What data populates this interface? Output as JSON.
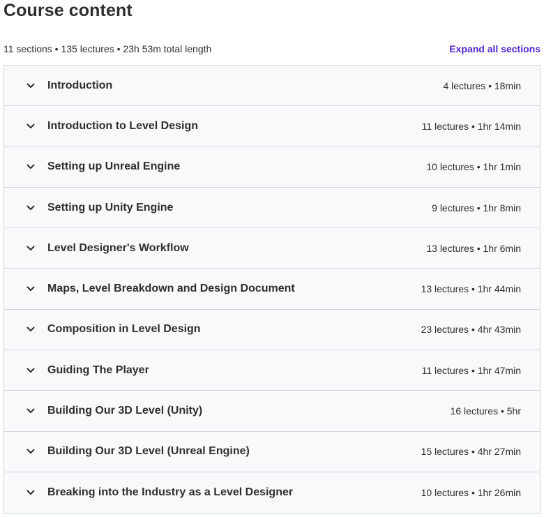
{
  "header": {
    "title": "Course content",
    "summary": "11 sections • 135 lectures • 23h 53m total length",
    "expand_all_label": "Expand all sections"
  },
  "sections": [
    {
      "title": "Introduction",
      "meta": "4 lectures • 18min"
    },
    {
      "title": "Introduction to Level Design",
      "meta": "11 lectures • 1hr 14min"
    },
    {
      "title": "Setting up Unreal Engine",
      "meta": "10 lectures • 1hr 1min"
    },
    {
      "title": "Setting up Unity Engine",
      "meta": "9 lectures • 1hr 8min"
    },
    {
      "title": "Level Designer's Workflow",
      "meta": "13 lectures • 1hr 6min"
    },
    {
      "title": "Maps, Level Breakdown and Design Document",
      "meta": "13 lectures • 1hr 44min"
    },
    {
      "title": "Composition in Level Design",
      "meta": "23 lectures • 4hr 43min"
    },
    {
      "title": "Guiding The Player",
      "meta": "11 lectures • 1hr 47min"
    },
    {
      "title": "Building Our 3D Level (Unity)",
      "meta": "16 lectures • 5hr"
    },
    {
      "title": "Building Our 3D Level (Unreal Engine)",
      "meta": "15 lectures • 4hr 27min"
    },
    {
      "title": "Breaking into the Industry as a Level Designer",
      "meta": "10 lectures • 1hr 26min"
    }
  ],
  "icons": {
    "section_toggle": "chevron-down-icon"
  },
  "colors": {
    "accent": "#5624d0",
    "row_background": "#f7f9fa",
    "border": "#d1d7dc",
    "text": "#2d2f31"
  }
}
